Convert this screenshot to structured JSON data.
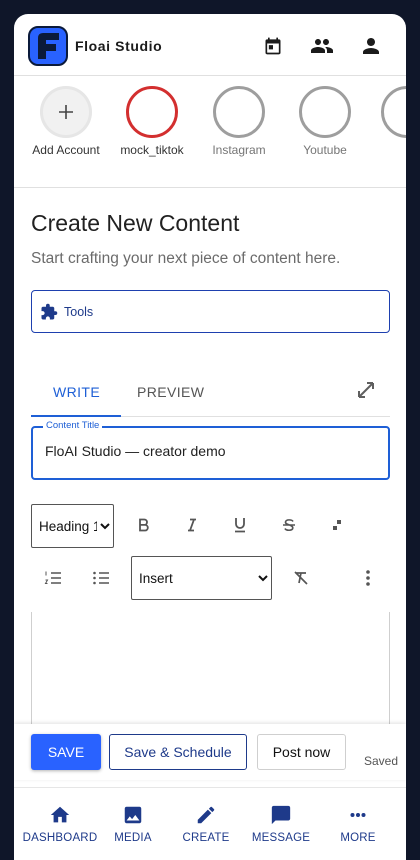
{
  "app": {
    "title": "Floai Studio"
  },
  "colors": {
    "primary": "#1e5fd6",
    "brand_navy": "#1e3a8a",
    "active_account": "#d32f2f",
    "save_button": "#2962ff"
  },
  "top_icons": [
    "calendar-icon",
    "people-icon",
    "person-icon"
  ],
  "accounts": [
    {
      "label": "Add Account",
      "icon": "plus-icon"
    },
    {
      "label": "mock_tiktok"
    },
    {
      "label": "Instagram"
    },
    {
      "label": "Youtube"
    }
  ],
  "page": {
    "title": "Create New Content",
    "subtitle": "Start crafting your next piece of content here."
  },
  "tools": {
    "label": "Tools",
    "icon": "puzzle-icon"
  },
  "tabs": {
    "write": "WRITE",
    "preview": "PREVIEW"
  },
  "content_title": {
    "label": "Content Title",
    "value": "FloAI Studio — creator demo"
  },
  "toolbar": {
    "heading_select": {
      "selected": "Heading 1"
    },
    "insert_select": {
      "selected": "Insert"
    }
  },
  "actions": {
    "save": "SAVE",
    "save_schedule": "Save & Schedule",
    "post_now": "Post now",
    "status": "Saved"
  },
  "nav": [
    {
      "label": "DASHBOARD",
      "icon": "home-icon"
    },
    {
      "label": "MEDIA",
      "icon": "image-icon"
    },
    {
      "label": "CREATE",
      "icon": "pencil-icon"
    },
    {
      "label": "MESSAGE",
      "icon": "message-icon"
    },
    {
      "label": "MORE",
      "icon": "more-horiz-icon"
    }
  ]
}
